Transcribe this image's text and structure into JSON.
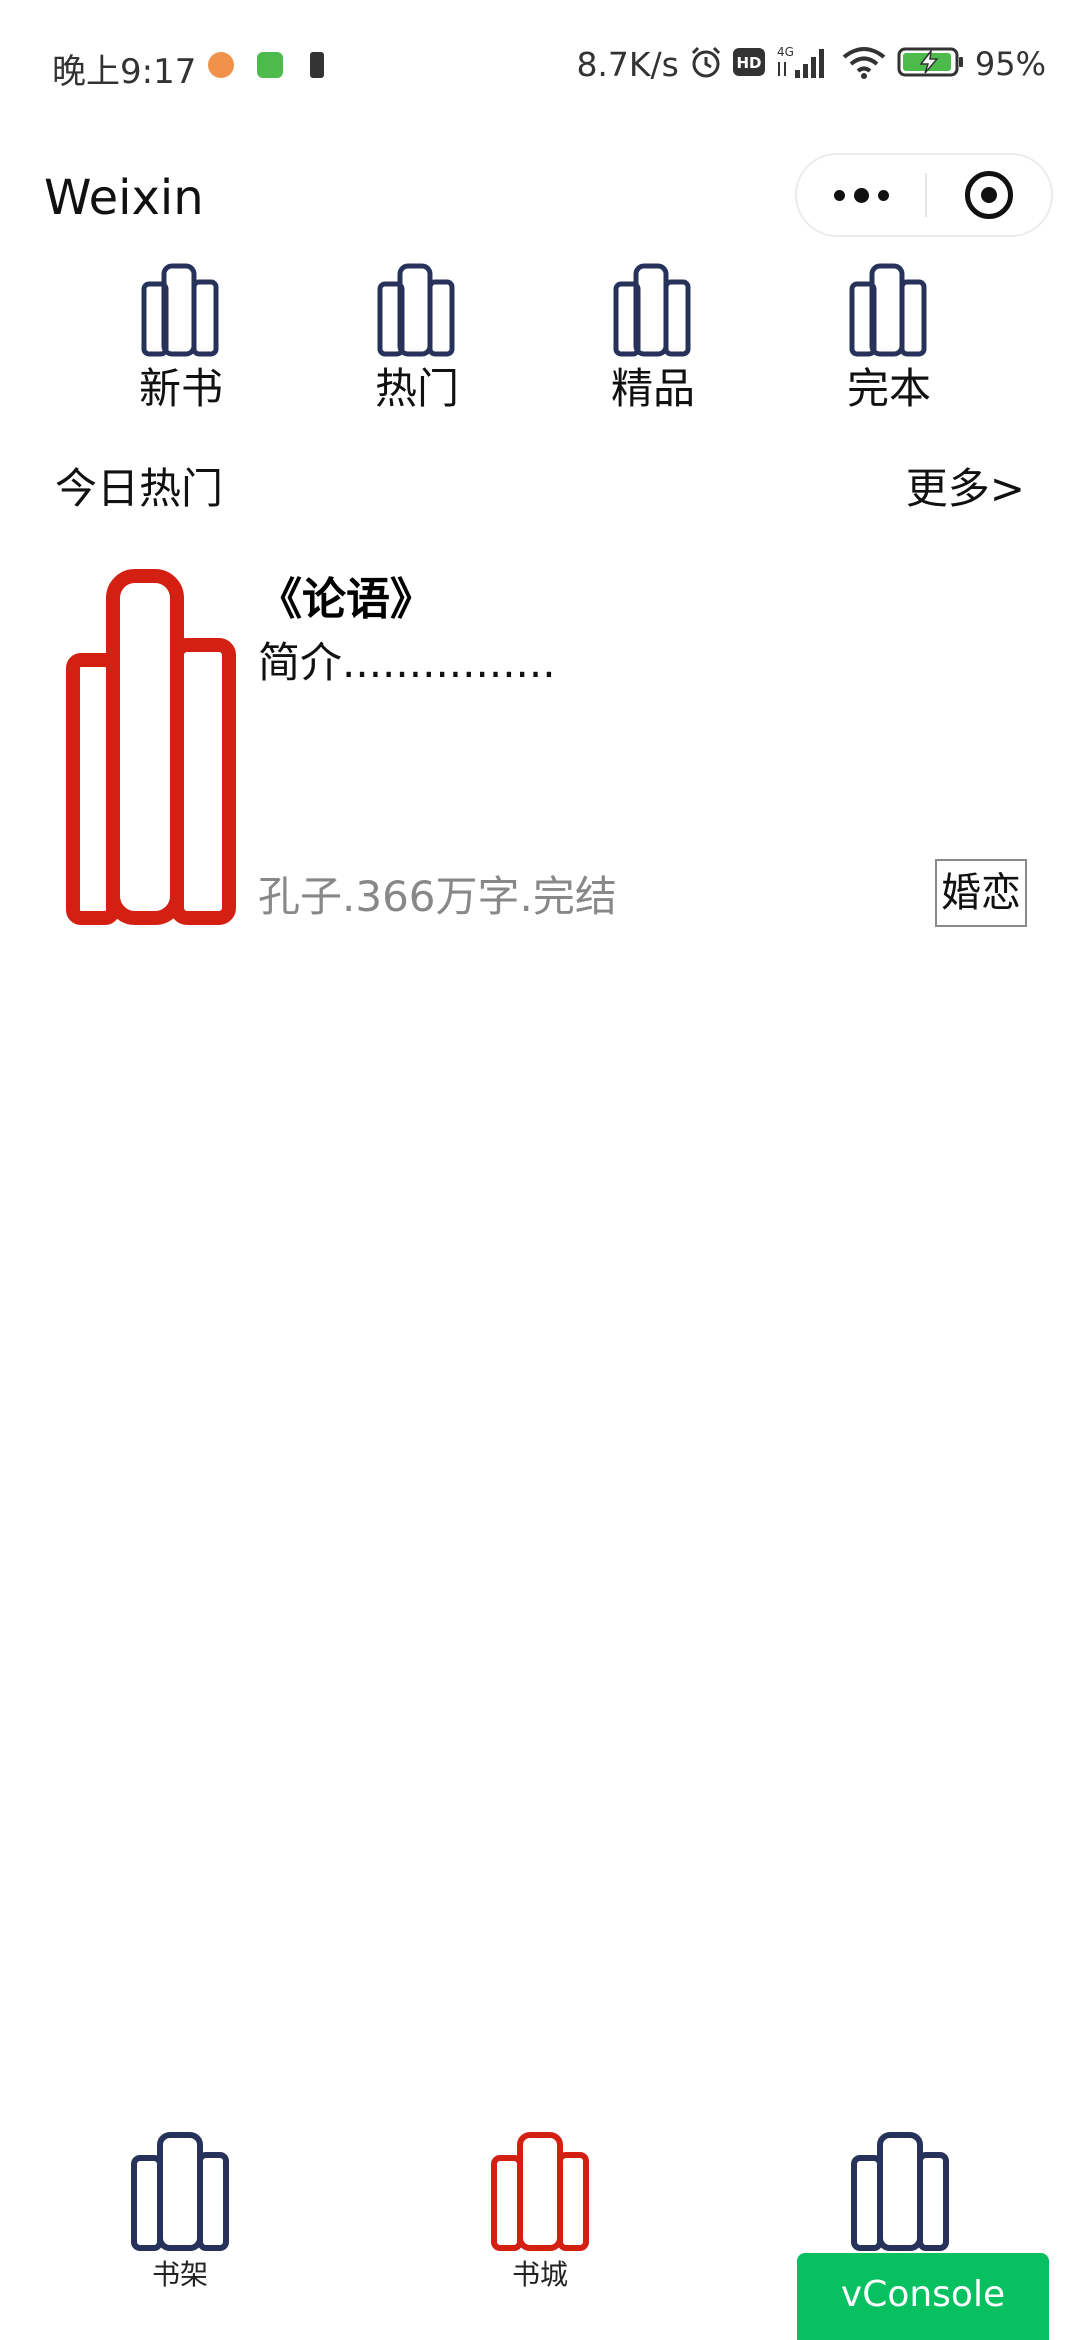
{
  "status_bar": {
    "time": "晚上9:17",
    "net_speed": "8.7K/s",
    "battery": "95%",
    "icons": [
      "message-icon",
      "app-icon",
      "notification-icon",
      "alarm-icon",
      "hd-icon",
      "signal-4g-icon",
      "wifi-icon",
      "battery-charging-icon"
    ]
  },
  "header": {
    "title": "Weixin",
    "capsule_icons": [
      "more-icon",
      "close-miniprogram-icon"
    ]
  },
  "categories": [
    {
      "label": "新书",
      "icon": "book-stack-icon"
    },
    {
      "label": "热门",
      "icon": "book-stack-icon"
    },
    {
      "label": "精品",
      "icon": "book-stack-icon"
    },
    {
      "label": "完本",
      "icon": "book-stack-icon"
    }
  ],
  "section": {
    "title": "今日热门",
    "more": "更多>"
  },
  "book": {
    "title": "《论语》",
    "intro": "简介................",
    "meta": "孔子.366万字.完结",
    "tag": "婚恋",
    "cover_icon": "book-cover-icon"
  },
  "tabbar": [
    {
      "label": "书架",
      "active": false
    },
    {
      "label": "书城",
      "active": true
    },
    {
      "label": "",
      "active": false
    }
  ],
  "vconsole": {
    "label": "vConsole"
  },
  "colors": {
    "icon_dark": "#27325a",
    "accent_red": "#d42012",
    "meta_gray": "#888888",
    "vconsole_green": "#07c160"
  }
}
